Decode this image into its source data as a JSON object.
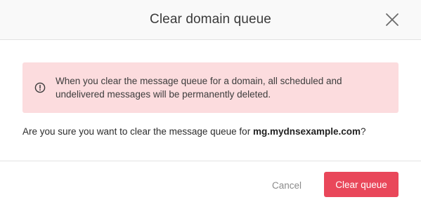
{
  "header": {
    "title": "Clear domain queue",
    "close_icon": "close-icon"
  },
  "alert": {
    "icon": "exclamation-circle-icon",
    "text": "When you clear the message queue for a domain, all scheduled and undelivered messages will be permanently deleted.",
    "background_color": "#fcdcde"
  },
  "confirm": {
    "prefix": "Are you sure you want to clear the message queue for ",
    "domain": "mg.mydnsexample.com",
    "suffix": "?"
  },
  "footer": {
    "cancel_label": "Cancel",
    "clear_label": "Clear queue",
    "danger_color": "#e9475a"
  }
}
